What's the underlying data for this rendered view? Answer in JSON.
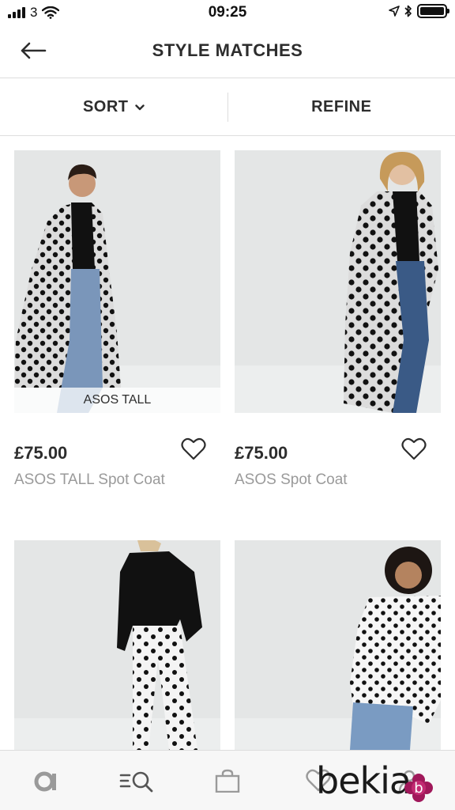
{
  "status_bar": {
    "carrier": "3",
    "time": "09:25"
  },
  "header": {
    "title": "STYLE MATCHES",
    "back_icon": "back-arrow-icon"
  },
  "filters": {
    "sort_label": "SORT",
    "refine_label": "REFINE"
  },
  "products": [
    {
      "badge": "ASOS TALL",
      "price": "£75.00",
      "name": "ASOS TALL Spot Coat",
      "image": "woman in polka-dot long coat and jeans"
    },
    {
      "badge": "",
      "price": "£75.00",
      "name": "ASOS Spot Coat",
      "image": "blonde woman in polka-dot coat and jeans"
    },
    {
      "image": "woman in black sweatshirt and polka-dot jeans"
    },
    {
      "image": "woman in polka-dot blouse and jeans"
    }
  ],
  "tab_bar": {
    "items": [
      "home-icon",
      "search-icon",
      "bag-icon",
      "saved-icon",
      "account-icon"
    ]
  },
  "watermark": {
    "text": "bekia",
    "mark": "b"
  },
  "colors": {
    "text": "#2d2d2d",
    "muted": "#9a9a9a",
    "divider": "#dddddd",
    "image_bg": "#e4e6e6",
    "tab_icon": "#9a9a9a"
  }
}
